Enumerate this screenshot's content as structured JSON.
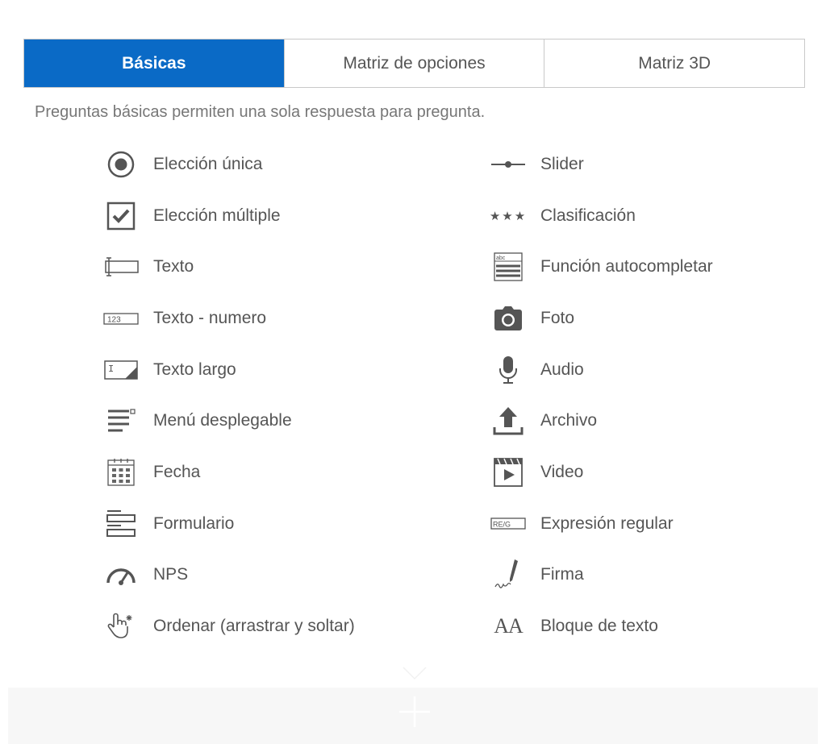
{
  "tabs": [
    {
      "label": "Básicas",
      "active": true
    },
    {
      "label": "Matriz de opciones",
      "active": false
    },
    {
      "label": "Matriz 3D",
      "active": false
    }
  ],
  "description": "Preguntas básicas permiten una sola respuesta para pregunta.",
  "left_items": [
    {
      "label": "Elección única",
      "icon": "radio-icon"
    },
    {
      "label": "Elección múltiple",
      "icon": "checkbox-icon"
    },
    {
      "label": "Texto",
      "icon": "text-input-icon"
    },
    {
      "label": "Texto - numero",
      "icon": "number-input-icon"
    },
    {
      "label": "Texto largo",
      "icon": "textarea-icon"
    },
    {
      "label": "Menú desplegable",
      "icon": "dropdown-icon"
    },
    {
      "label": "Fecha",
      "icon": "calendar-icon"
    },
    {
      "label": "Formulario",
      "icon": "form-icon"
    },
    {
      "label": "NPS",
      "icon": "gauge-icon"
    },
    {
      "label": "Ordenar (arrastrar y soltar)",
      "icon": "drag-hand-icon"
    }
  ],
  "right_items": [
    {
      "label": "Slider",
      "icon": "slider-icon"
    },
    {
      "label": "Clasificación",
      "icon": "stars-icon"
    },
    {
      "label": "Función autocompletar",
      "icon": "autocomplete-icon"
    },
    {
      "label": "Foto",
      "icon": "camera-icon"
    },
    {
      "label": "Audio",
      "icon": "microphone-icon"
    },
    {
      "label": "Archivo",
      "icon": "upload-icon"
    },
    {
      "label": "Video",
      "icon": "video-icon"
    },
    {
      "label": "Expresión regular",
      "icon": "regex-icon"
    },
    {
      "label": "Firma",
      "icon": "signature-icon"
    },
    {
      "label": "Bloque de texto",
      "icon": "text-block-icon"
    }
  ],
  "icon_text": {
    "number": "123",
    "regex": "RE/G",
    "abc": "abc",
    "textarea": "I",
    "font": "AA",
    "stars": "★★★"
  },
  "colors": {
    "accent": "#0a6ac6",
    "text": "#555555",
    "border": "#c9c9c9"
  }
}
